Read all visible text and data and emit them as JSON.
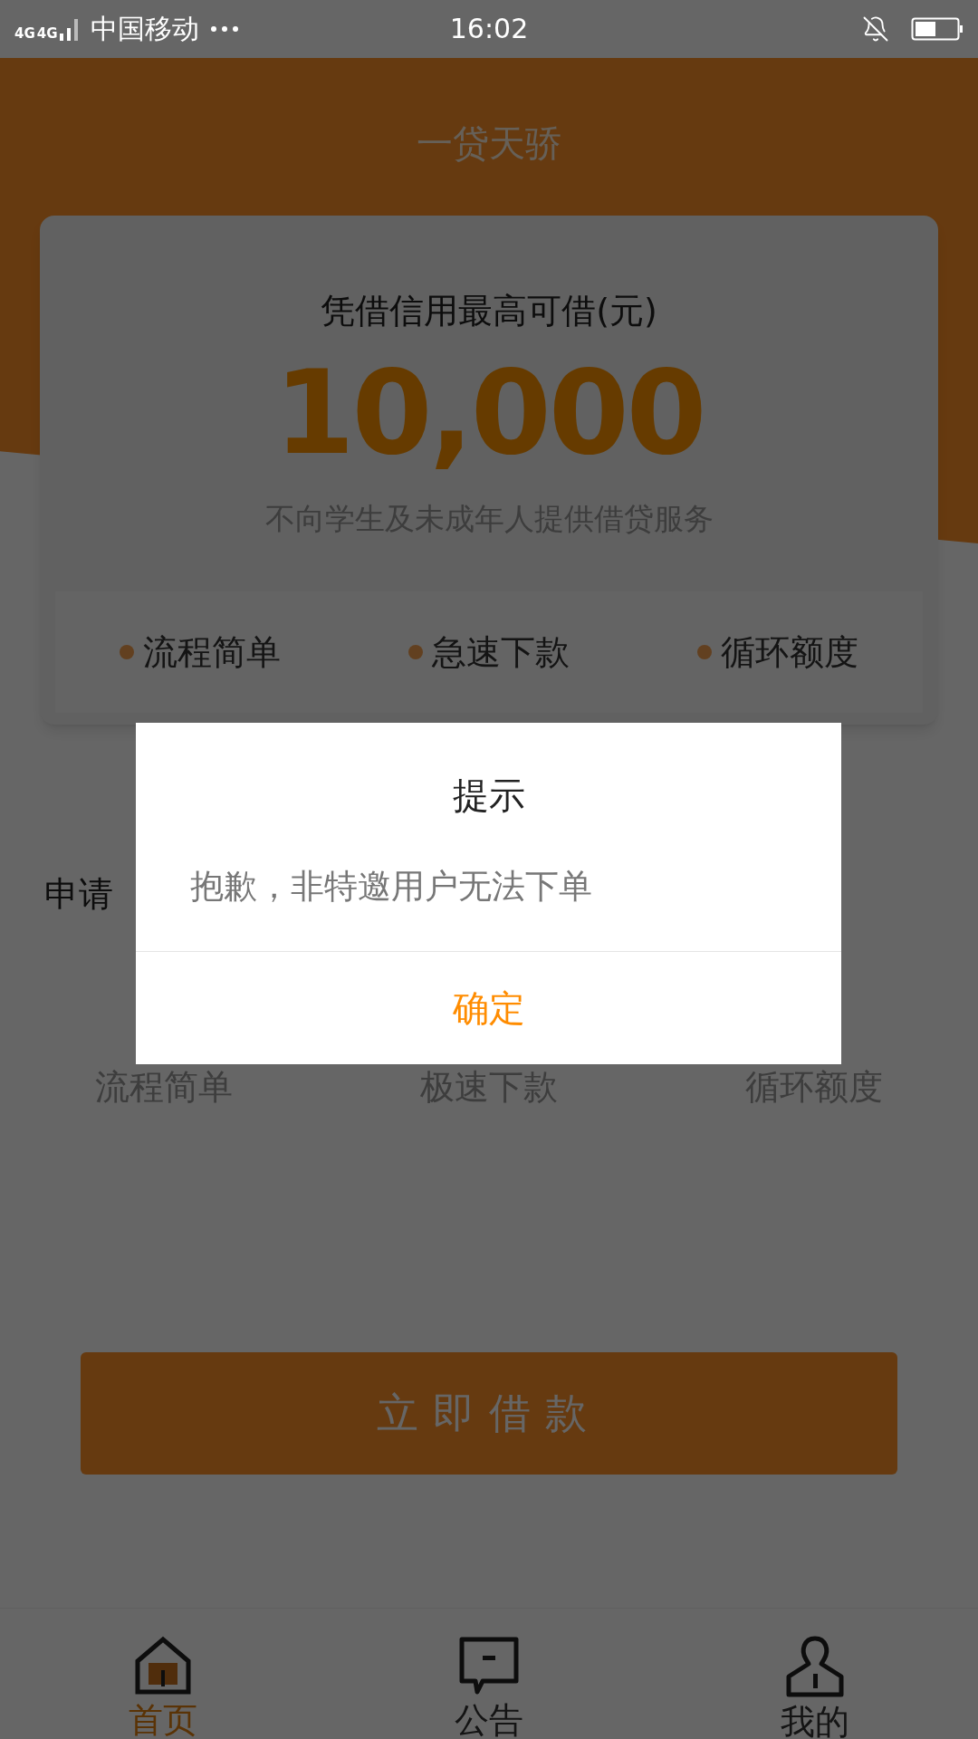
{
  "status_bar": {
    "network_labels": [
      "4G",
      "4G"
    ],
    "carrier": "中国移动",
    "time": "16:02"
  },
  "header": {
    "title": "一贷天骄"
  },
  "credit_card": {
    "title": "凭借信用最高可借(元)",
    "amount": "10,000",
    "notice": "不向学生及未成年人提供借贷服务",
    "features": [
      "流程简单",
      "急速下款",
      "循环额度"
    ]
  },
  "process": {
    "title": "申请",
    "steps": [
      "流程简单",
      "极速下款",
      "循环额度"
    ]
  },
  "borrow_button": "立即借款",
  "tab_bar": [
    {
      "label": "首页",
      "kind": "home",
      "selected": true
    },
    {
      "label": "公告",
      "kind": "notice",
      "selected": false
    },
    {
      "label": "我的",
      "kind": "profile",
      "selected": false
    }
  ],
  "dialog": {
    "title": "提示",
    "message": "抱歉，非特邀用户无法下单",
    "confirm": "确定"
  }
}
